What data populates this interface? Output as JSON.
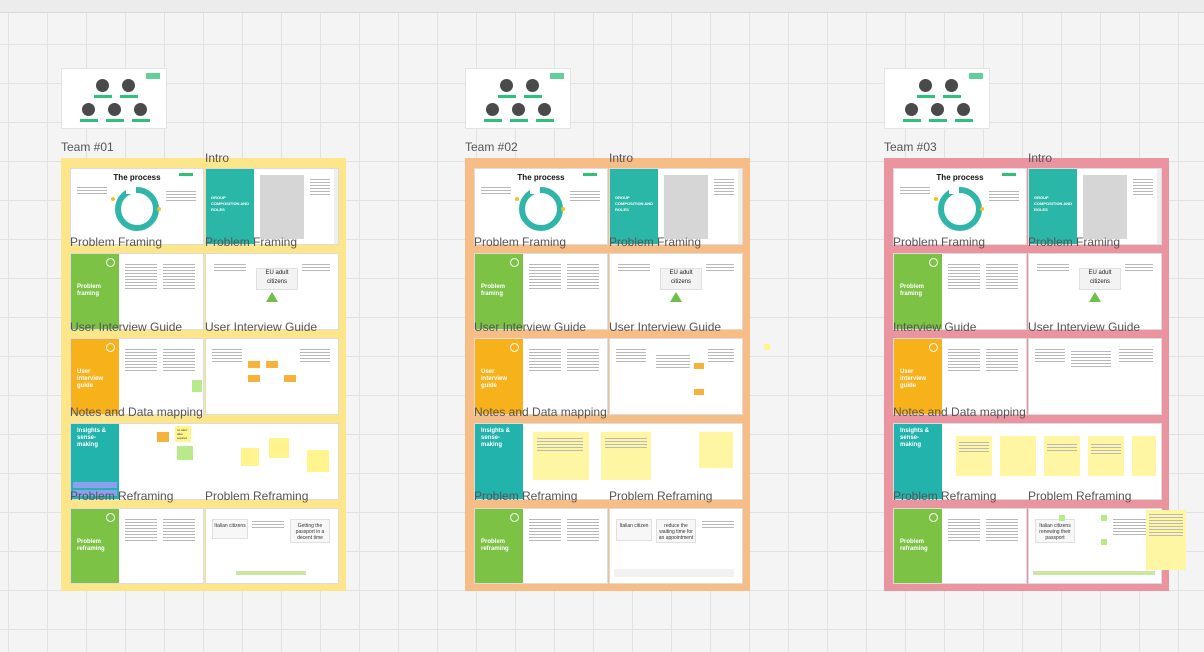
{
  "canvas": {
    "background": "#f4f4f4",
    "grid_color": "#e1e1e1"
  },
  "colors": {
    "green_panel": "#7cc245",
    "teal_panel": "#2bb7a7",
    "orange_panel": "#f7b21b",
    "insight_teal": "#22b3ad",
    "team1_frame": "#fde68a",
    "team2_frame": "#f7bd87",
    "team3_frame": "#e9949f"
  },
  "teams": [
    {
      "id": "team1",
      "label": "Team #01",
      "frame_color": "#fde68a",
      "labels": {
        "intro": "Intro",
        "pf_left": "Problem Framing",
        "pf_right": "Problem Framing",
        "uig_left": "User Interview Guide",
        "uig_right": "User Interview Guide",
        "notes": "Notes and Data mapping",
        "reframe_left": "Problem Reframing",
        "reframe_right": "Problem Reframing"
      },
      "slides": {
        "process_title": "The process",
        "intro_panel": "GROUP COMPOSITION AND ROLES",
        "pf_panel": "Problem framing",
        "pf_subject": "EU adult citizens",
        "uig_panel": "User interview guide",
        "insights_panel": "Insights & sense-making",
        "reframe_panel": "Problem reframing",
        "reframe_boxes": [
          "Italian citizens",
          "Getting the passport in a decent time"
        ],
        "sticky_alert": "no alert after expired"
      }
    },
    {
      "id": "team2",
      "label": "Team #02",
      "frame_color": "#f7bd87",
      "labels": {
        "intro": "Intro",
        "pf_left": "Problem Framing",
        "pf_right": "Problem Framing",
        "uig_left": "User Interview Guide",
        "uig_right": "User Interview Guide",
        "notes": "Notes and Data mapping",
        "reframe_left": "Problem Reframing",
        "reframe_right": "Problem Reframing"
      },
      "slides": {
        "process_title": "The process",
        "intro_panel": "GROUP COMPOSITION AND ROLES",
        "pf_panel": "Problem framing",
        "pf_subject": "EU adult citizens",
        "uig_panel": "User interview guide",
        "insights_panel": "Insights & sense-making",
        "reframe_panel": "Problem reframing",
        "reframe_boxes": [
          "Italian citizen",
          "reduce the waiting time for an appointment"
        ]
      }
    },
    {
      "id": "team3",
      "label": "Team #03",
      "frame_color": "#e9949f",
      "labels": {
        "intro": "Intro",
        "pf_left": "Problem Framing",
        "pf_right": "Problem Framing",
        "uig_left": "Interview Guide",
        "uig_right": "User Interview Guide",
        "notes": "Notes and Data mapping",
        "reframe_left": "Problem Reframing",
        "reframe_right": "Problem Reframing"
      },
      "slides": {
        "process_title": "The process",
        "intro_panel": "GROUP COMPOSITION AND ROLES",
        "pf_panel": "Problem framing",
        "pf_subject": "EU adult citizens",
        "uig_panel": "User interview guide",
        "insights_panel": "Insights & sense-making",
        "reframe_panel": "Problem reframing",
        "reframe_boxes": [
          "Italian citizens renewing their passport"
        ]
      }
    }
  ]
}
